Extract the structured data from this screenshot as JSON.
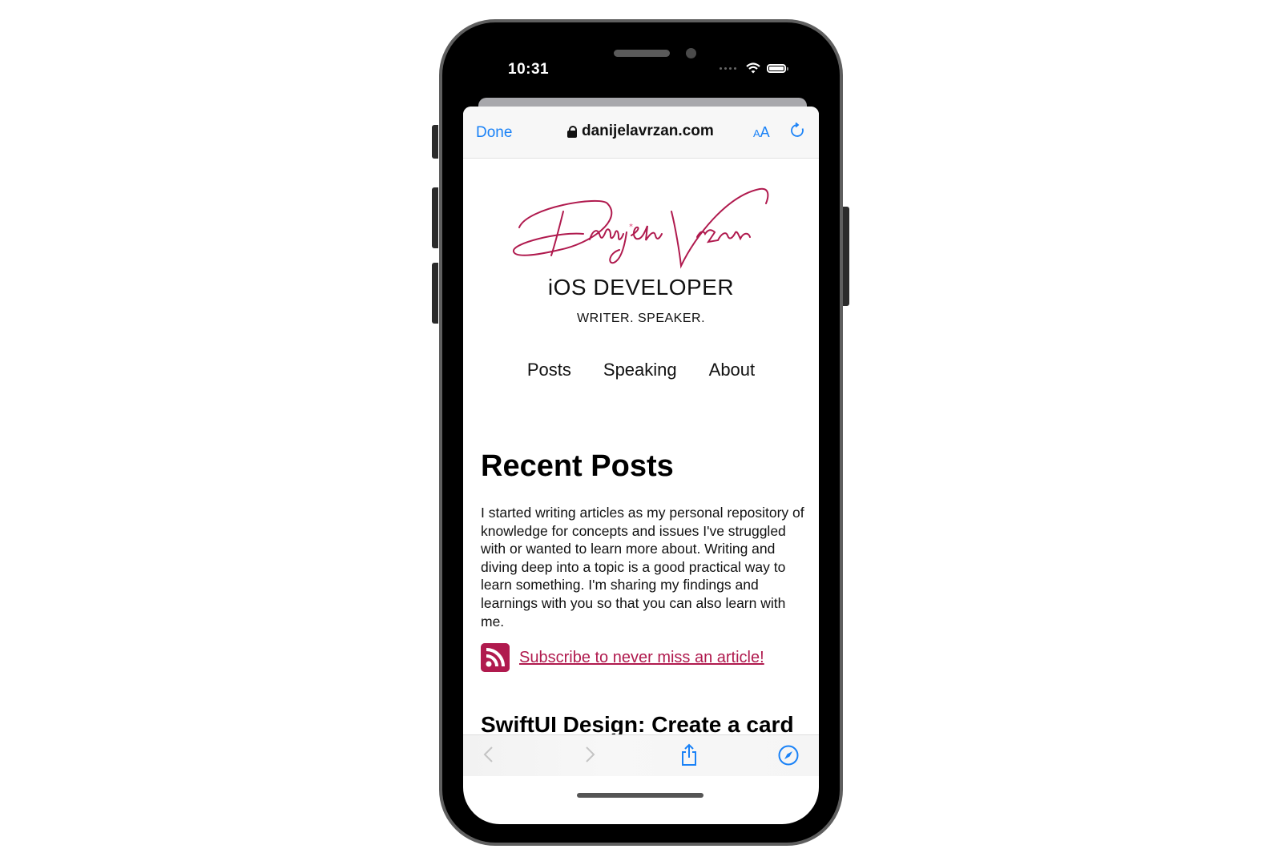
{
  "status_bar": {
    "time": "10:31"
  },
  "browser": {
    "done_label": "Done",
    "url": "danijelavrzan.com",
    "text_size_label_small": "A",
    "text_size_label_large": "A",
    "accent_color": "#1a82f7"
  },
  "site": {
    "logo_text": "Danijela Vrzan",
    "role": "iOS DEVELOPER",
    "subtitle": "WRITER. SPEAKER.",
    "brand_color": "#b01a4e",
    "nav": [
      {
        "label": "Posts"
      },
      {
        "label": "Speaking"
      },
      {
        "label": "About"
      }
    ],
    "section_heading": "Recent Posts",
    "intro": "I started writing articles as my personal repository of knowledge for concepts and issues I've struggled with or wanted to learn more about. Writing and diving deep into a topic is a good practical way to learn something. I'm sharing my findings and learnings with you so that you can also learn with me.",
    "subscribe_label": "Subscribe to never miss an article!",
    "first_post_title": "SwiftUI Design: Create a card"
  },
  "toolbar": {
    "icons": [
      "back-icon",
      "forward-icon",
      "share-icon",
      "compass-icon"
    ]
  }
}
